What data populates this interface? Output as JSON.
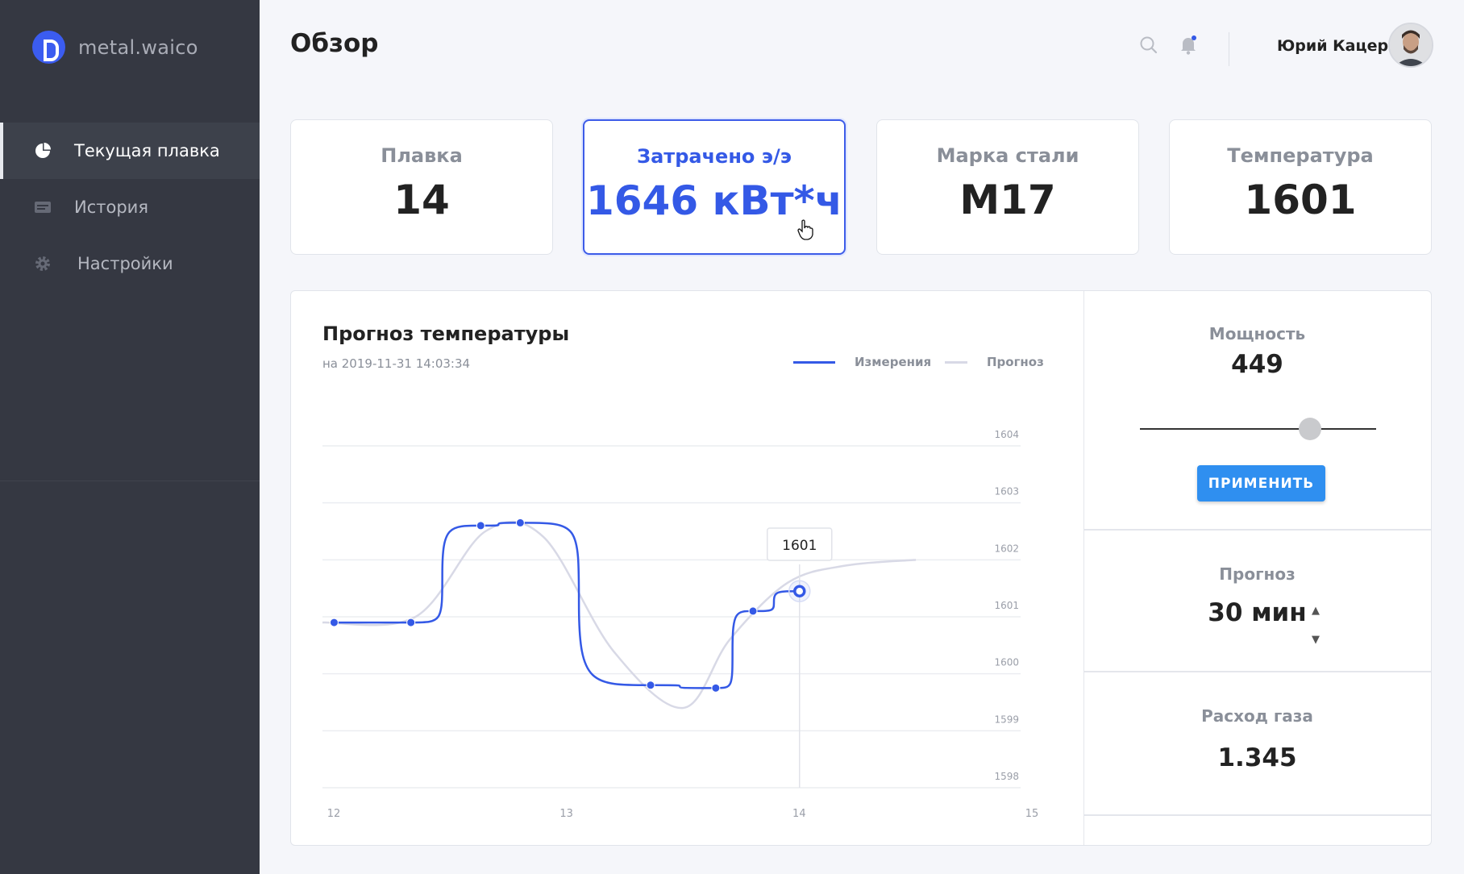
{
  "app": {
    "brand": "metal.waico"
  },
  "sidebar": {
    "items": [
      {
        "label": "Текущая плавка",
        "icon": "pie-chart-icon",
        "active": true
      },
      {
        "label": "История",
        "icon": "history-icon",
        "active": false
      },
      {
        "label": "Настройки",
        "icon": "gear-icon",
        "active": false
      }
    ]
  },
  "header": {
    "title": "Обзор",
    "user_name": "Юрий Кацер"
  },
  "cards": [
    {
      "label": "Плавка",
      "value": "14"
    },
    {
      "label": "Затрачено э/э",
      "value": "1646 кВт*ч",
      "active": true
    },
    {
      "label": "Марка стали",
      "value": "М17"
    },
    {
      "label": "Температура",
      "value": "1601"
    }
  ],
  "chart": {
    "title": "Прогноз температуры",
    "subtitle": "на 2019-11-31 14:03:34",
    "legend_measure": "Измерения",
    "legend_forecast": "Прогноз",
    "tooltip": "1601"
  },
  "controls": {
    "power_label": "Мощность",
    "power_value": "449",
    "power_level": 0.72,
    "apply_label": "ПРИМЕНИТЬ",
    "forecast_label": "Прогноз",
    "forecast_value": "30 мин",
    "gas_label": "Расход газа",
    "gas_value": "1.345"
  },
  "colors": {
    "accent": "#3459e6",
    "sidebar": "#353842",
    "button": "#2f8ff0"
  },
  "chart_data": {
    "type": "line",
    "xlabel": "",
    "ylabel": "",
    "xlim": [
      12,
      15
    ],
    "ylim": [
      1598,
      1604
    ],
    "x_ticks": [
      "12",
      "13",
      "14",
      "15"
    ],
    "y_ticks": [
      "1604",
      "1603",
      "1602",
      "1601",
      "1600",
      "1599",
      "1598"
    ],
    "series": [
      {
        "name": "Измерения",
        "color": "#3459e6",
        "x": [
          12.05,
          12.38,
          12.68,
          12.85,
          13.41,
          13.69,
          13.85,
          14.05
        ],
        "y": [
          1600.9,
          1600.9,
          1602.6,
          1602.65,
          1599.8,
          1599.75,
          1601.1,
          1601.45
        ]
      },
      {
        "name": "Прогноз",
        "color": "#d8d9e6",
        "x": [
          12.0,
          12.4,
          12.7,
          12.95,
          13.25,
          13.55,
          13.75,
          14.0,
          14.25,
          14.55
        ],
        "y": [
          1600.9,
          1601.0,
          1602.5,
          1602.4,
          1600.4,
          1599.4,
          1600.6,
          1601.6,
          1601.9,
          1602.0
        ]
      }
    ]
  }
}
